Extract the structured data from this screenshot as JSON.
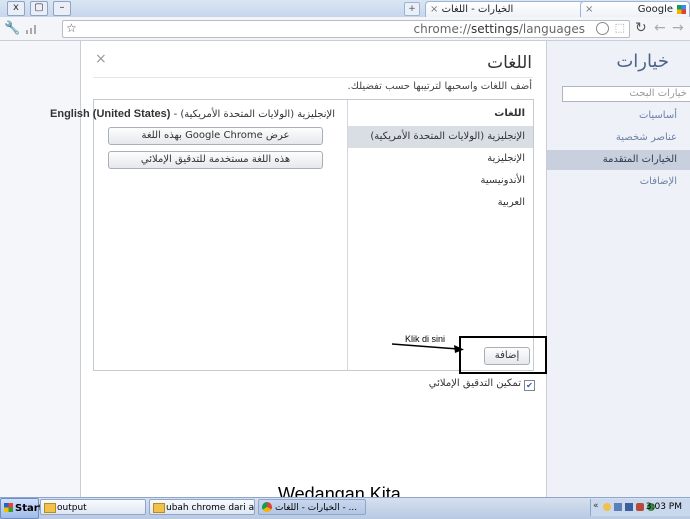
{
  "titlebar": {
    "tab_title": "الخيارات - اللغات",
    "google_tab": "Google",
    "close_glyph": "x",
    "restore_glyph": "▢",
    "minimize_glyph": "–"
  },
  "toolbar": {
    "url_prefix": "chrome://",
    "url_settings": "settings",
    "url_suffix": "/languages"
  },
  "sidebar": {
    "title": "خيارات",
    "search_placeholder": "خيارات البحث",
    "items": [
      {
        "label": "أساسيات"
      },
      {
        "label": "عناصر شخصية"
      },
      {
        "label": "الخيارات المتقدمة"
      },
      {
        "label": "الإضافات"
      }
    ]
  },
  "dialog": {
    "title": "اللغات",
    "close_glyph": "×",
    "hint": "أضف اللغات واسحبها لترتيبها حسب تفضيلك.",
    "list_header": "اللغات",
    "languages": [
      {
        "label": "الإنجليزية (الولايات المتحدة الأمريكية)"
      },
      {
        "label": "الإنجليزية"
      },
      {
        "label": "الأندونيسية"
      },
      {
        "label": "العربية"
      }
    ],
    "detail_title_ar": "الإنجليزية (الولايات المتحدة الأمريكية) -",
    "detail_title_en": "English (United States)",
    "display_button": "عرض Google Chrome بهذه اللغة",
    "spell_button": "هذه اللغة مستخدمة للتدقيق الإملائي",
    "add_button": "إضافة",
    "spellcheck_label": "تمكين التدقيق الإملائي"
  },
  "annotation": {
    "note": "Klik di sini"
  },
  "taskbar": {
    "start": "Start",
    "tasks": [
      {
        "label": "output"
      },
      {
        "label": "ubah chrome dari arab k..."
      },
      {
        "label": "الخيارات - اللغات - ..."
      }
    ],
    "clock": "3:03 PM"
  },
  "watermark": "Wedangan Kita"
}
